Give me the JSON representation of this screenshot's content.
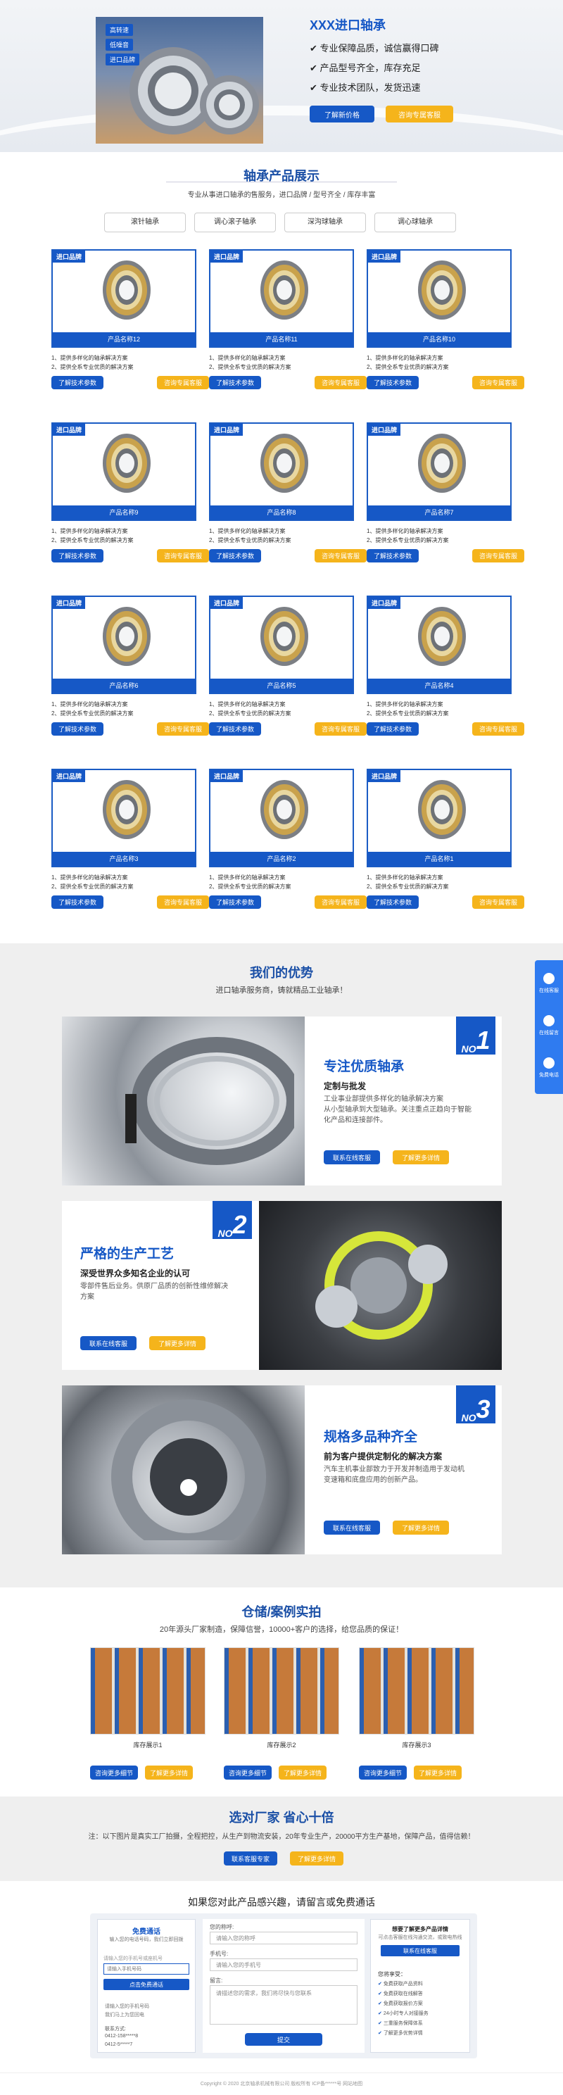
{
  "hero": {
    "badges": [
      "高转速",
      "低噪音",
      "进口品牌"
    ],
    "title": "XXX进口轴承",
    "points": [
      "专业保障品质，诚信赢得口碑",
      "产品型号齐全，库存充足",
      "专业技术团队，发货迅速"
    ],
    "btn_price": "了解新价格",
    "btn_consult": "咨询专属客服"
  },
  "products": {
    "title": "轴承产品展示",
    "subtitle": "专业从事进口轴承的售服务，进口品牌 / 型号齐全 / 库存丰富",
    "tabs": [
      "滚针轴承",
      "调心滚子轴承",
      "深沟球轴承",
      "调心球轴承"
    ],
    "badge": "进口品牌",
    "items": [
      {
        "name": "产品名称12"
      },
      {
        "name": "产品名称11"
      },
      {
        "name": "产品名称10"
      },
      {
        "name": "产品名称9"
      },
      {
        "name": "产品名称8"
      },
      {
        "name": "产品名称7"
      },
      {
        "name": "产品名称6"
      },
      {
        "name": "产品名称5"
      },
      {
        "name": "产品名称4"
      },
      {
        "name": "产品名称3"
      },
      {
        "name": "产品名称2"
      },
      {
        "name": "产品名称1"
      }
    ],
    "line1": "1、提供多样化的轴承解决方案",
    "line2": "2、提供全系专业优质的解决方案",
    "btn_params": "了解技术参数",
    "btn_consult": "咨询专属客服"
  },
  "advantages": {
    "title": "我们的优势",
    "subtitle": "进口轴承服务商，铸就精品工业轴承！",
    "items": [
      {
        "no": "NO",
        "num": "1",
        "heading": "专注优质轴承",
        "sub": "定制与批发",
        "text": "工业事业部提供多样化的轴承解决方案\n从小型轴承到大型轴承。关注重点正趋向于智能化产品和连接部件。",
        "btn1": "联系在线客服",
        "btn2": "了解更多详情"
      },
      {
        "no": "NO",
        "num": "2",
        "heading": "严格的生产工艺",
        "sub": "深受世界众多知名企业的认可",
        "text": "零部件售后业务。供原厂品质的创新性维修解决方案",
        "btn1": "联系在线客服",
        "btn2": "了解更多详情"
      },
      {
        "no": "NO",
        "num": "3",
        "heading": "规格多品种齐全",
        "sub": "前为客户提供定制化的解决方案",
        "text": "汽车主机事业部致力于开发并制造用于发动机\n变速箱和底盘应用的创新产品。",
        "btn1": "联系在线客服",
        "btn2": "了解更多详情"
      }
    ]
  },
  "float_bar": [
    {
      "label": "在线客服"
    },
    {
      "label": "在线留言"
    },
    {
      "label": "免费电话"
    }
  ],
  "cases": {
    "title": "仓储/案例实拍",
    "subtitle": "20年源头厂家制造，保障信誉，10000+客户的选择，给您品质的保证！",
    "items": [
      {
        "caption": "库存展示1"
      },
      {
        "caption": "库存展示2"
      },
      {
        "caption": "库存展示3"
      }
    ],
    "btn1": "咨询更多细节",
    "btn2": "了解更多详情"
  },
  "factory": {
    "title": "选对厂家 省心十倍",
    "text": "注：以下图片是真实工厂拍摄，全程把控，从生产到物流安装，20年专业生产，20000平方生产基地，保障产品，值得信赖！",
    "btn1": "联系客服专家",
    "btn2": "了解更多详情"
  },
  "contact": {
    "title": "如果您对此产品感兴趣，请留言或免费通话",
    "left": {
      "heading": "免费通话",
      "tip": "输入您的电话号码，我们立即回拨",
      "hint": "请输入您的手机号或座机号",
      "placeholder": "请输入手机号码",
      "btn": "点击免费通话",
      "notes": [
        "请输入您的手机号码",
        "我们马上为您回电"
      ],
      "contact_label": "联系方式:",
      "phone": "0412-158*****8",
      "tel": "0412-5*****7"
    },
    "form": {
      "name_label": "您的称呼:",
      "name_ph": "请输入您的称呼",
      "phone_label": "手机号:",
      "phone_ph": "请输入您的手机号",
      "msg_label": "留言:",
      "msg_ph": "请描述您的需求，我们将尽快与您联系",
      "submit": "提交"
    },
    "right": {
      "heading": "想要了解更多产品详情",
      "desc": "可点击客服在线沟通交流，或致电热线",
      "btn": "联系在线客服",
      "service_label": "您将享受：",
      "services": [
        "免费获取产品资料",
        "免费获取在线解答",
        "免费获取报价方案",
        "24小时专人对接服务",
        "三重服务保障体系",
        "了解更多优势详情"
      ]
    }
  },
  "footer": {
    "copyright": "Copyright © 2020 北京轴承机械有限公司 版权所有 ICP备******号 网站地图"
  }
}
